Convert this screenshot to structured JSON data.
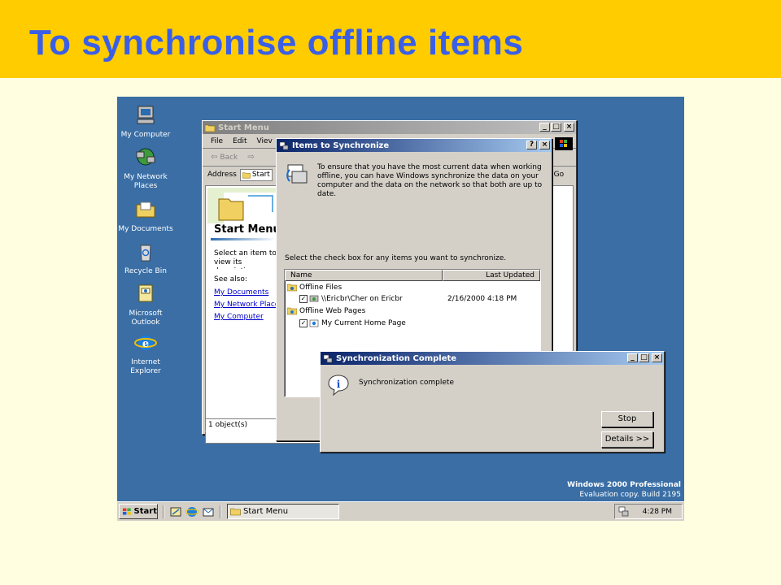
{
  "slide": {
    "title": "To synchronise offline items"
  },
  "desktop": {
    "icons": [
      {
        "label": "My Computer",
        "icon": "my-computer-icon"
      },
      {
        "label": "My Network Places",
        "icon": "network-places-icon"
      },
      {
        "label": "My Documents",
        "icon": "my-documents-icon"
      },
      {
        "label": "Recycle Bin",
        "icon": "recycle-bin-icon"
      },
      {
        "label": "Microsoft Outlook",
        "icon": "outlook-icon"
      },
      {
        "label": "Internet Explorer",
        "icon": "internet-explorer-icon"
      }
    ],
    "watermark": {
      "line1": "Windows 2000 Professional",
      "line2": "Evaluation copy. Build 2195"
    }
  },
  "start_menu_window": {
    "title": "Start Menu",
    "menu": [
      "File",
      "Edit",
      "Viev"
    ],
    "toolbar": {
      "back": "Back"
    },
    "address": {
      "label": "Address",
      "value": "Start",
      "go": "Go"
    },
    "heading": "Start Menu",
    "description": "Select an item to view its description.",
    "see_also": "See also:",
    "links": [
      "My Documents",
      "My Network Places",
      "My Computer"
    ],
    "status": "1 object(s)"
  },
  "items_window": {
    "title": "Items to Synchronize",
    "intro": "To ensure that you have the most current data when working offline, you can have Windows synchronize the data on your computer and the data on the network so that both are up to date.",
    "instruction": "Select the check box for any items you want to synchronize.",
    "columns": {
      "name": "Name",
      "updated": "Last Updated"
    },
    "groups": [
      {
        "label": "Offline Files",
        "items": [
          {
            "name": "\\\\Ericbr\\Cher on Ericbr",
            "updated": "2/16/2000 4:18 PM"
          }
        ]
      },
      {
        "label": "Offline Web Pages",
        "items": [
          {
            "name": "My Current Home Page",
            "updated": ""
          }
        ]
      }
    ]
  },
  "complete_window": {
    "title": "Synchronization Complete",
    "message": "Synchronization complete",
    "stop": "Stop",
    "details": "Details >>"
  },
  "taskbar": {
    "start": "Start",
    "task": "Start Menu",
    "clock": "4:28 PM"
  },
  "colors": {
    "title_band": "#FFCC00",
    "title_text": "#3A5FE6",
    "desktop": "#3A6EA5",
    "active_title": "#0A246A"
  }
}
